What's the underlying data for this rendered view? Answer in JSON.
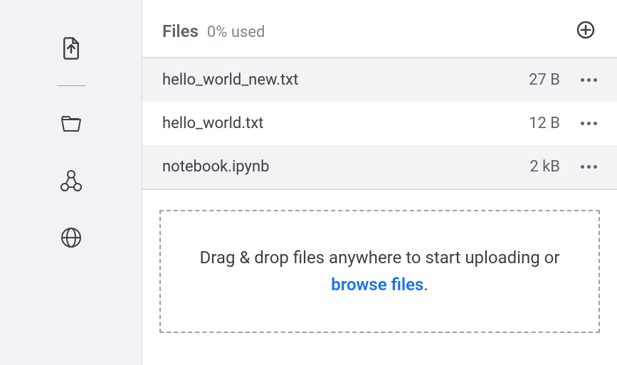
{
  "header": {
    "title": "Files",
    "usage": "0% used"
  },
  "files": [
    {
      "name": "hello_world_new.txt",
      "size": "27 B"
    },
    {
      "name": "hello_world.txt",
      "size": "12 B"
    },
    {
      "name": "notebook.ipynb",
      "size": "2 kB"
    }
  ],
  "dropzone": {
    "line_prefix": "Drag & drop files anywhere to start uploading or ",
    "browse": "browse files",
    "suffix": "."
  }
}
